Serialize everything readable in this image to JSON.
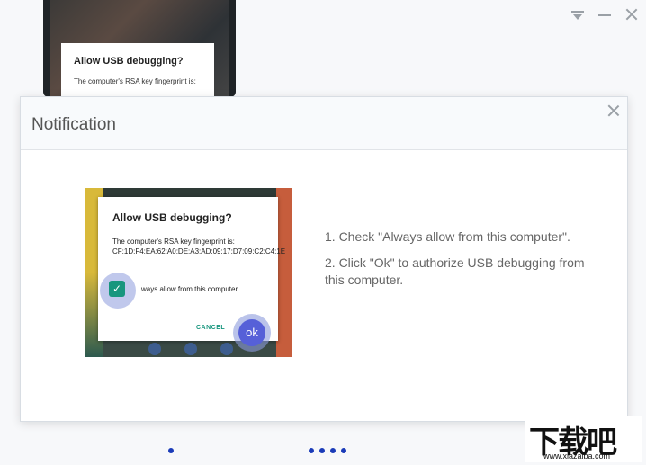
{
  "background_window": {
    "phone_dialog": {
      "title": "Allow USB debugging?",
      "text": "The computer's RSA key fingerprint is:"
    },
    "window_controls": [
      "dropdown-icon",
      "minimize-icon",
      "close-icon"
    ],
    "page_dots": {
      "left": 1,
      "center": 4
    }
  },
  "modal": {
    "title": "Notification",
    "illustration": {
      "dialog_title": "Allow USB debugging?",
      "dialog_text": "The computer's RSA key fingerprint is:",
      "fingerprint": "CF:1D:F4:EA:62:A0:DE:A3:AD:09:17:D7:09:C2:C4:1E",
      "checkbox_label": "ways allow from this computer",
      "checkbox_checked": true,
      "cancel_label": "CANCEL",
      "ok_label": "ok"
    },
    "instructions": {
      "step1": "1. Check \"Always allow from this computer\".",
      "step2": "2. Click \"Ok\" to authorize USB debugging from this computer."
    }
  },
  "watermark": {
    "logo_text": "下载吧",
    "url": "www.xiazaiba.com"
  },
  "colors": {
    "accent_green": "#17967e",
    "ok_blue": "#5660d8",
    "dot_blue": "#1a3bb8"
  }
}
